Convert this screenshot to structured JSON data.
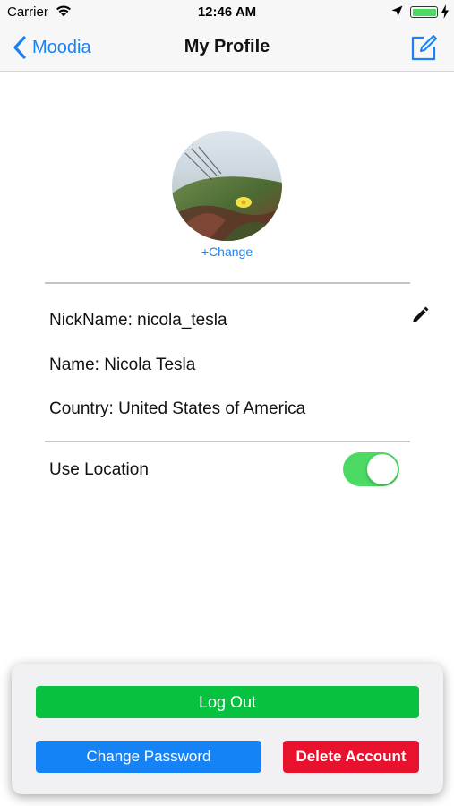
{
  "status_bar": {
    "carrier": "Carrier",
    "time": "12:46 AM",
    "wifi_icon": "wifi-icon",
    "location_icon": "location-arrow-icon",
    "battery_icon": "battery-full-charging-icon",
    "battery_color": "#4cd964"
  },
  "nav": {
    "back_label": "Moodia",
    "title": "My Profile",
    "back_icon": "chevron-left-icon",
    "edit_icon": "compose-icon",
    "tint_color": "#1a82f7"
  },
  "profile": {
    "change_photo_label": "+Change",
    "nickname_label": "NickName: nicola_tesla",
    "name_label": "Name: Nicola Tesla",
    "country_label": "Country: United States of America",
    "edit_icon": "pencil-icon"
  },
  "settings": {
    "use_location_label": "Use Location",
    "use_location_enabled": true,
    "toggle_on_color": "#4cd964"
  },
  "actions": {
    "logout_label": "Log Out",
    "change_password_label": "Change Password",
    "delete_account_label": "Delete Account",
    "colors": {
      "logout": "#06c23e",
      "change_password": "#1583f6",
      "delete_account": "#e8122f"
    }
  }
}
